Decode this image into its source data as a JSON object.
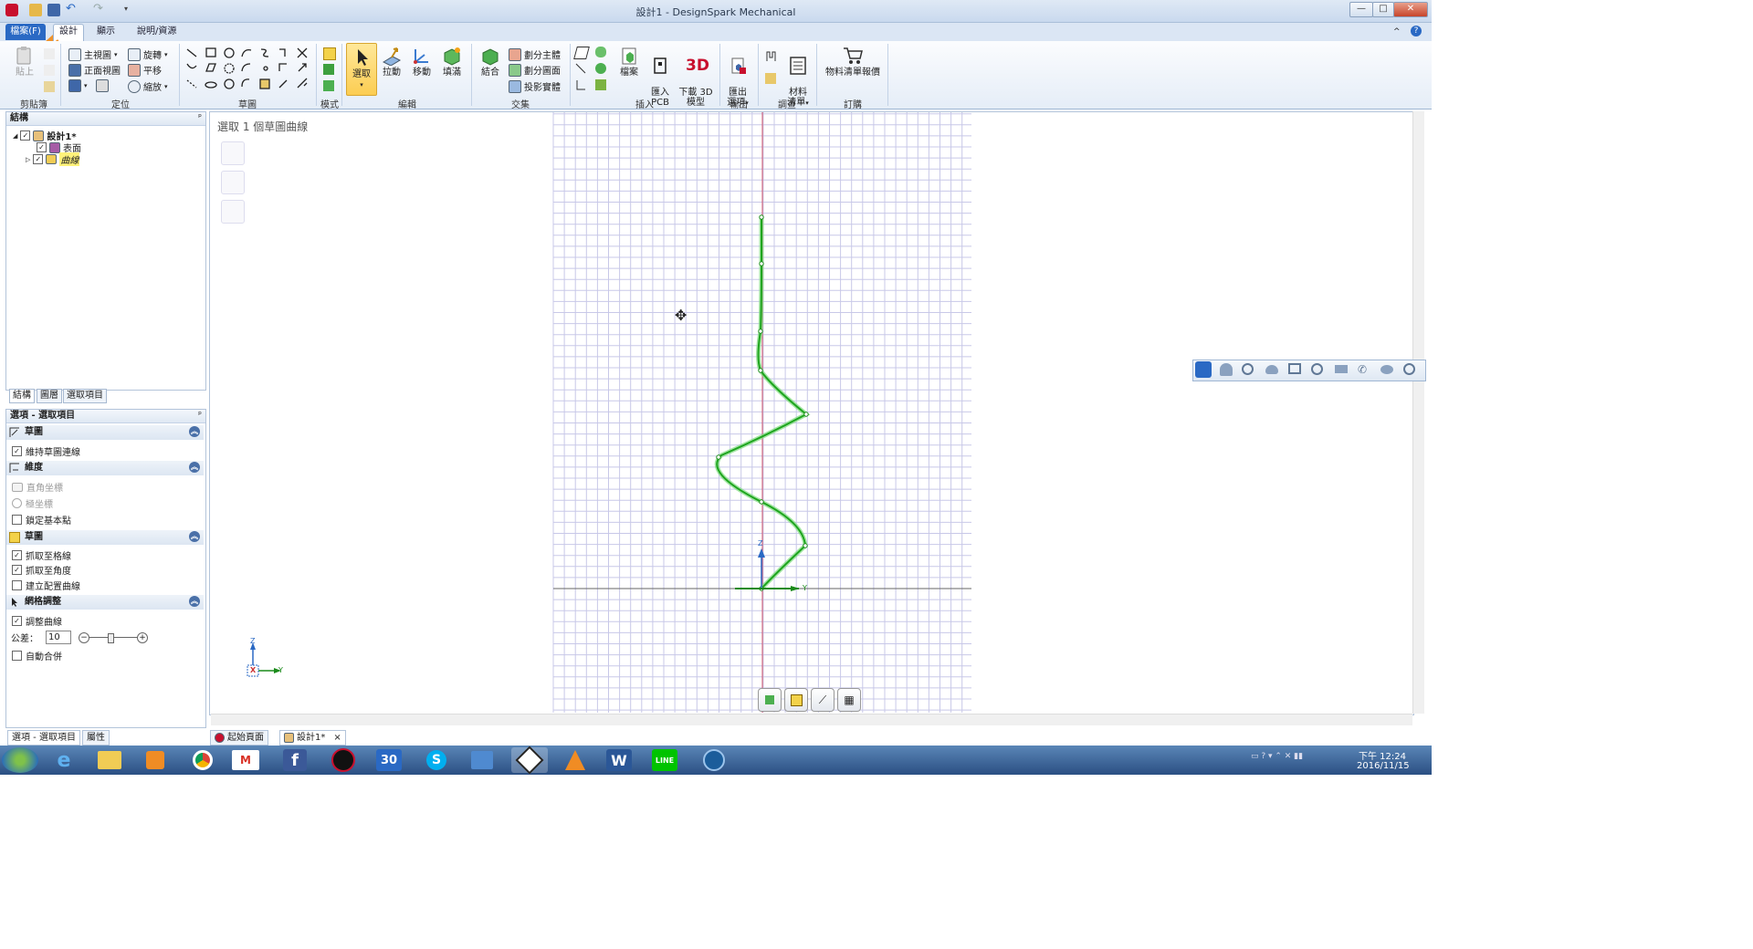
{
  "window": {
    "title": "設計1 - DesignSpark Mechanical",
    "controls": {
      "minimize": "—",
      "maximize": "□",
      "close": "✕"
    }
  },
  "tabs": {
    "file": "檔案(F)",
    "design": "設計",
    "display": "顯示",
    "help": "說明/資源"
  },
  "ribbon": {
    "clipboard": {
      "paste": "貼上",
      "label": "剪貼簿"
    },
    "orient": {
      "home_view": "主視圖",
      "front_view": "正面視圖",
      "rotate": "旋轉",
      "pan": "平移",
      "zoom": "縮放",
      "label": "定位"
    },
    "sketch": {
      "label": "草圖"
    },
    "mode": {
      "label": "模式"
    },
    "edit": {
      "select": "選取",
      "pull": "拉動",
      "move": "移動",
      "fill": "填滿",
      "label": "編輯"
    },
    "intersect": {
      "combine": "結合",
      "split_body": "劃分主體",
      "split_face": "劃分圖面",
      "project": "投影實體",
      "label": "交集"
    },
    "insert": {
      "file": "檔案",
      "import_pcb": "匯入\nPCB",
      "download_3d": "下載 3D\n模型",
      "download_3d_badge": "3D",
      "label": "插入"
    },
    "output": {
      "export": "匯出\n選項",
      "label": "輸出"
    },
    "investigate": {
      "bom": "材料\n清單",
      "label": "調查"
    },
    "order": {
      "bom_quote": "物料清單報價",
      "label": "訂購"
    }
  },
  "structure_panel": {
    "title": "結構",
    "pin": "ᵖ",
    "tree": [
      {
        "label": "設計1*",
        "checked": true,
        "bold": true
      },
      {
        "label": "表面",
        "checked": true,
        "bold": false
      },
      {
        "label": "曲線",
        "checked": true,
        "bold": false,
        "italic": true
      }
    ],
    "tabs": [
      "結構",
      "圖層",
      "選取項目"
    ]
  },
  "options_panel": {
    "title": "選項 - 選取項目",
    "pin": "ᵖ",
    "sections": [
      {
        "title": "草圖",
        "options": [
          {
            "label": "維持草圖連線",
            "checked": true,
            "disabled": false
          }
        ]
      },
      {
        "title": "維度",
        "options": [
          {
            "label": "直角坐標",
            "checked": false,
            "disabled": true,
            "kind": "icon"
          },
          {
            "label": "極坐標",
            "checked": false,
            "disabled": true,
            "kind": "radio"
          },
          {
            "label": "鎖定基本點",
            "checked": false,
            "disabled": false
          }
        ]
      },
      {
        "title": "草圖",
        "options": [
          {
            "label": "抓取至格線",
            "checked": true,
            "disabled": false
          },
          {
            "label": "抓取至角度",
            "checked": true,
            "disabled": false
          },
          {
            "label": "建立配置曲線",
            "checked": false,
            "disabled": false
          }
        ]
      },
      {
        "title": "網格調整",
        "options": [
          {
            "label": "調整曲線",
            "checked": true,
            "disabled": false
          },
          {
            "label": "公差：",
            "kind": "slider",
            "value": "10"
          },
          {
            "label": "自動合併",
            "checked": false,
            "disabled": false
          }
        ]
      }
    ],
    "tabs": [
      "選項 - 選取項目",
      "屬性"
    ]
  },
  "canvas": {
    "status": "選取 1 個草圖曲線",
    "axis_labels": {
      "z": "Z",
      "y": "Y",
      "x": "X"
    }
  },
  "document_tabs": [
    {
      "label": "起始頁面",
      "active": false
    },
    {
      "label": "設計1*",
      "active": true,
      "close": "×"
    }
  ],
  "taskbar": {
    "apps": [
      "start",
      "ie",
      "explorer",
      "media",
      "chrome",
      "gmail",
      "facebook",
      "player",
      "calendar",
      "skype",
      "remote",
      "designspark",
      "vlc",
      "word",
      "line",
      "teamviewer"
    ],
    "calendar_day": "30",
    "word_letter": "W",
    "line_label": "LINE",
    "gmail_letter": "M",
    "facebook_letter": "f",
    "clock_time": "下午 12:24",
    "clock_date": "2016/11/15"
  },
  "colors": {
    "accent": "#2a69c4",
    "curve": "#1ea51e",
    "grid": "#c8c8e8",
    "axis_red": "#d0506a"
  }
}
